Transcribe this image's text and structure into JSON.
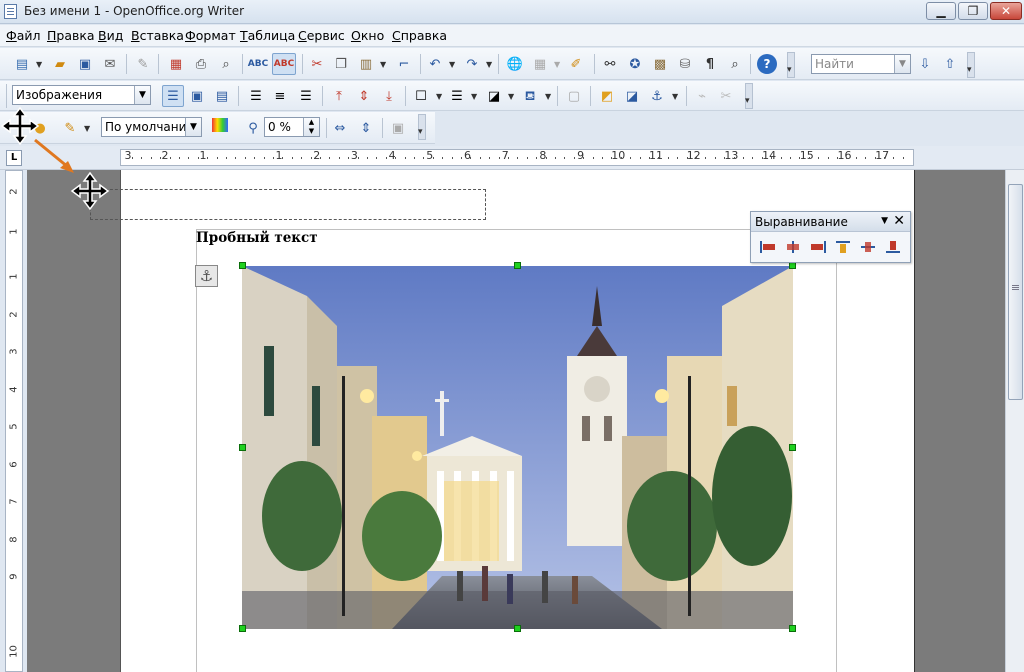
{
  "window": {
    "title": "Без имени 1 - OpenOffice.org Writer",
    "buttons": {
      "minimize": "▁",
      "maximize": "❐",
      "close": "✕"
    }
  },
  "menu": [
    "Файл",
    "Правка",
    "Вид",
    "Вставка",
    "Формат",
    "Таблица",
    "Сервис",
    "Окно",
    "Справка"
  ],
  "standard_toolbar": {
    "find_placeholder": "Найти",
    "icons": [
      "new-icon",
      "open-icon",
      "save-icon",
      "email-icon",
      "edit-icon",
      "pdf-icon",
      "print-icon",
      "preview-icon",
      "spellcheck-icon",
      "autospell-icon",
      "cut-icon",
      "copy-icon",
      "paste-icon",
      "format-paintbrush-icon",
      "undo-icon",
      "redo-icon",
      "hyperlink-icon",
      "table-icon",
      "draw-icon",
      "find-replace-icon",
      "navigator-icon",
      "gallery-icon",
      "datasource-icon",
      "formatting-marks-icon",
      "zoom-icon",
      "help-icon",
      "find-down-icon",
      "find-up-icon"
    ]
  },
  "frame_toolbar": {
    "style_value": "Изображения",
    "icons": [
      "wrap-off-icon",
      "wrap-page-icon",
      "wrap-optimal-icon",
      "align-left-icon",
      "align-center-icon",
      "align-right-icon",
      "align-top-icon",
      "align-middle-icon",
      "align-bottom-icon",
      "borders-icon",
      "line-style-icon",
      "border-color-icon",
      "background-color-icon",
      "link-frames-icon",
      "bring-forward-icon",
      "send-backward-icon",
      "anchor-icon",
      "unlink-icon",
      "cut-link-icon"
    ]
  },
  "picture_toolbar": {
    "filter_value": "По умолчани",
    "transparency_value": "0 %",
    "icons": [
      "filter-icon",
      "graphic-mode-icon",
      "color-icon",
      "transparency-icon",
      "flip-vertical-icon",
      "flip-horizontal-icon",
      "picture-properties-icon"
    ]
  },
  "ruler": {
    "tab_selector": "L",
    "left_labels": [
      "3",
      "2",
      "1"
    ],
    "right_labels": [
      "1",
      "2",
      "3",
      "4",
      "5",
      "6",
      "7",
      "8",
      "9",
      "10",
      "11",
      "12",
      "13",
      "14",
      "15",
      "16",
      "17"
    ],
    "vertical_labels": [
      "2",
      "1",
      "1",
      "2",
      "3",
      "4",
      "5",
      "6",
      "7",
      "8",
      "9",
      "10"
    ]
  },
  "document": {
    "heading": "Пробный текст",
    "anchor_symbol": "⚓"
  },
  "align_panel": {
    "title": "Выравнивание",
    "menu_arrow": "▼",
    "close": "✕",
    "icons": [
      "align-left-obj-icon",
      "align-center-obj-icon",
      "align-right-obj-icon",
      "align-top-obj-icon",
      "align-vcenter-obj-icon",
      "align-bottom-obj-icon"
    ]
  },
  "colors": {
    "sky_top": "#6a82c4",
    "sky_bottom": "#a8b8e3",
    "building": "#e8dcc0",
    "handle": "#1fd11f",
    "arrow": "#e07820"
  }
}
